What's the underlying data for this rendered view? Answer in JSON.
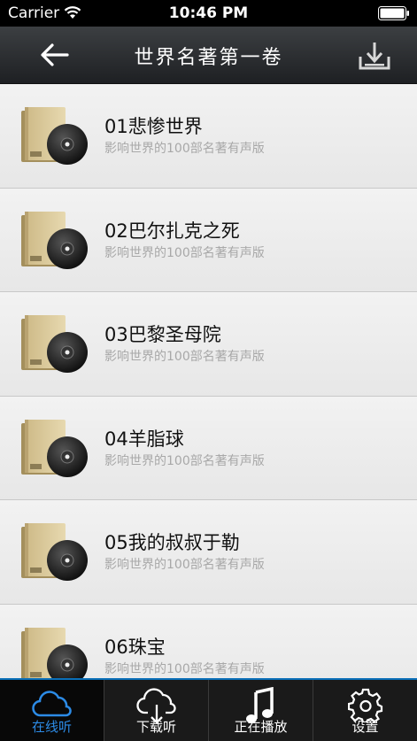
{
  "status_bar": {
    "carrier": "Carrier",
    "time": "10:46 PM"
  },
  "nav": {
    "title": "世界名著第一卷",
    "back_icon": "back-arrow-icon",
    "download_icon": "download-icon"
  },
  "colors": {
    "accent": "#2c8be6",
    "nav_bg": "#2b2e31",
    "tab_bg": "#1a1a1a"
  },
  "items": [
    {
      "title": "01悲惨世界",
      "subtitle": "影响世界的100部名著有声版"
    },
    {
      "title": "02巴尔扎克之死",
      "subtitle": "影响世界的100部名著有声版"
    },
    {
      "title": "03巴黎圣母院",
      "subtitle": "影响世界的100部名著有声版"
    },
    {
      "title": "04羊脂球",
      "subtitle": "影响世界的100部名著有声版"
    },
    {
      "title": "05我的叔叔于勒",
      "subtitle": "影响世界的100部名著有声版"
    },
    {
      "title": "06珠宝",
      "subtitle": "影响世界的100部名著有声版"
    }
  ],
  "tabs": [
    {
      "label": "在线听",
      "icon": "cloud-icon",
      "active": true
    },
    {
      "label": "下载听",
      "icon": "cloud-download-icon",
      "active": false
    },
    {
      "label": "正在播放",
      "icon": "music-note-icon",
      "active": false
    },
    {
      "label": "设置",
      "icon": "gear-icon",
      "active": false
    }
  ]
}
